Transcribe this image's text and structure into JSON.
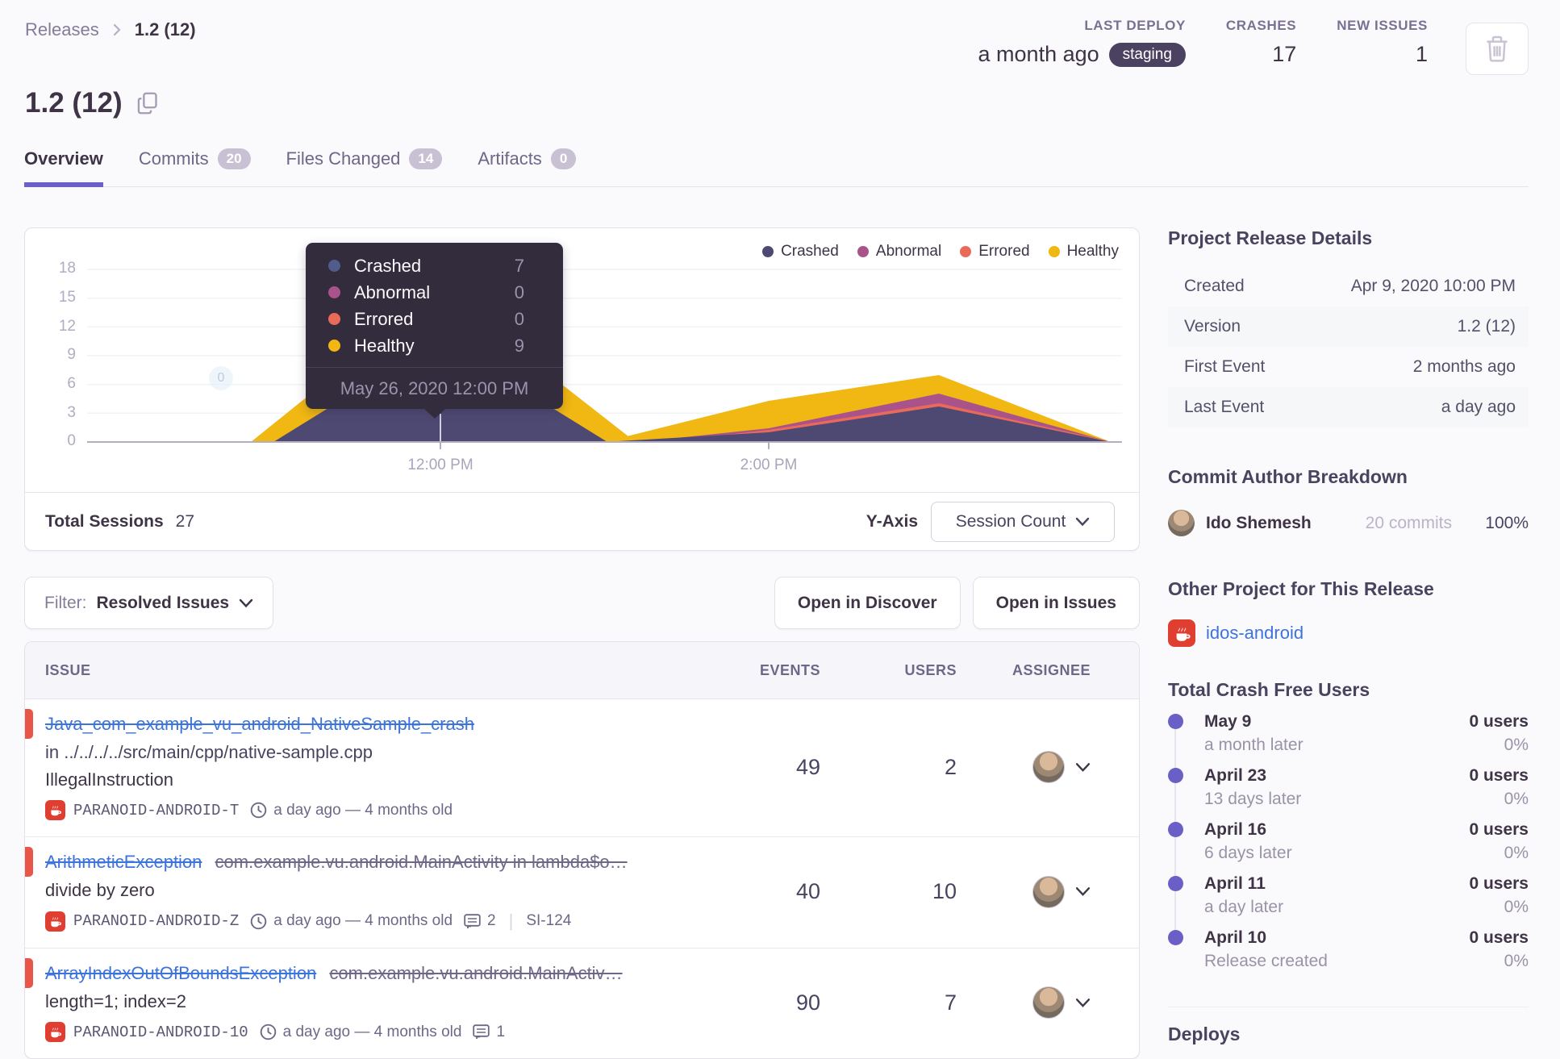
{
  "breadcrumb": {
    "root": "Releases",
    "current": "1.2 (12)"
  },
  "header": {
    "title": "1.2 (12)",
    "stats": [
      {
        "label": "LAST DEPLOY",
        "value": "a month ago",
        "badge": "staging"
      },
      {
        "label": "CRASHES",
        "value": "17",
        "badge": ""
      },
      {
        "label": "NEW ISSUES",
        "value": "1",
        "badge": ""
      }
    ]
  },
  "tabs": [
    {
      "label": "Overview",
      "count": "",
      "active": true
    },
    {
      "label": "Commits",
      "count": "20",
      "active": false
    },
    {
      "label": "Files Changed",
      "count": "14",
      "active": false
    },
    {
      "label": "Artifacts",
      "count": "0",
      "active": false
    }
  ],
  "chart": {
    "type": "area",
    "legend": [
      {
        "label": "Crashed",
        "color": "#4E4973"
      },
      {
        "label": "Abnormal",
        "color": "#AA538B"
      },
      {
        "label": "Errored",
        "color": "#EA6A5A"
      },
      {
        "label": "Healthy",
        "color": "#F1B712"
      }
    ],
    "tooltip": {
      "rows": [
        {
          "label": "Crashed",
          "value": "7",
          "color": "#4F5C8C"
        },
        {
          "label": "Abnormal",
          "value": "0",
          "color": "#AA538B"
        },
        {
          "label": "Errored",
          "value": "0",
          "color": "#EA6A5A"
        },
        {
          "label": "Healthy",
          "value": "9",
          "color": "#F1B712"
        }
      ],
      "date": "May 26, 2020 12:00 PM"
    },
    "y_ticks": [
      "18",
      "15",
      "12",
      "9",
      "6",
      "3",
      "0"
    ],
    "x_ticks": [
      "12:00 PM",
      "2:00 PM"
    ],
    "zero_marker": "0",
    "footer": {
      "total_label": "Total Sessions",
      "total_value": "27",
      "yaxis_label": "Y-Axis",
      "yaxis_value": "Session Count"
    }
  },
  "controls": {
    "filter_label": "Filter:",
    "filter_value": "Resolved Issues",
    "buttons": [
      {
        "label": "Open in Discover"
      },
      {
        "label": "Open in Issues"
      }
    ]
  },
  "table": {
    "columns": {
      "issue": "ISSUE",
      "events": "EVENTS",
      "users": "USERS",
      "assignee": "ASSIGNEE"
    },
    "rows": [
      {
        "title": "Java_com_example_vu_android_NativeSample_crash",
        "title_extra": "",
        "location": "in ../../../../src/main/cpp/native-sample.cpp",
        "subtitle": "IllegalInstruction",
        "project": "PARANOID-ANDROID-T",
        "age": "a day ago — 4 months old",
        "comments": "",
        "annotation": "",
        "events": "49",
        "users": "2"
      },
      {
        "title": "ArithmeticException",
        "title_extra": "com.example.vu.android.MainActivity in lambda$o…",
        "location": "",
        "subtitle": "divide by zero",
        "project": "PARANOID-ANDROID-Z",
        "age": "a day ago — 4 months old",
        "comments": "2",
        "annotation": "SI-124",
        "events": "40",
        "users": "10"
      },
      {
        "title": "ArrayIndexOutOfBoundsException",
        "title_extra": "com.example.vu.android.MainActiv…",
        "location": "",
        "subtitle": "length=1; index=2",
        "project": "PARANOID-ANDROID-10",
        "age": "a day ago — 4 months old",
        "comments": "1",
        "annotation": "",
        "events": "90",
        "users": "7"
      }
    ]
  },
  "sidebar": {
    "details_heading": "Project Release Details",
    "details": [
      {
        "label": "Created",
        "value": "Apr 9, 2020 10:00 PM"
      },
      {
        "label": "Version",
        "value": "1.2 (12)"
      },
      {
        "label": "First Event",
        "value": "2 months ago"
      },
      {
        "label": "Last Event",
        "value": "a day ago"
      }
    ],
    "commit_heading": "Commit Author Breakdown",
    "commit_author": {
      "name": "Ido Shemesh",
      "commits": "20 commits",
      "pct": "100%"
    },
    "other_heading": "Other Project for This Release",
    "other_project": "idos-android",
    "cfu_heading": "Total Crash Free Users",
    "timeline": [
      {
        "date": "May 9",
        "note": "a month later",
        "users": "0 users",
        "pct": "0%"
      },
      {
        "date": "April 23",
        "note": "13 days later",
        "users": "0 users",
        "pct": "0%"
      },
      {
        "date": "April 16",
        "note": "6 days later",
        "users": "0 users",
        "pct": "0%"
      },
      {
        "date": "April 11",
        "note": "a day later",
        "users": "0 users",
        "pct": "0%"
      },
      {
        "date": "April 10",
        "note": "Release created",
        "users": "0 users",
        "pct": "0%"
      }
    ],
    "deploys_heading": "Deploys"
  }
}
